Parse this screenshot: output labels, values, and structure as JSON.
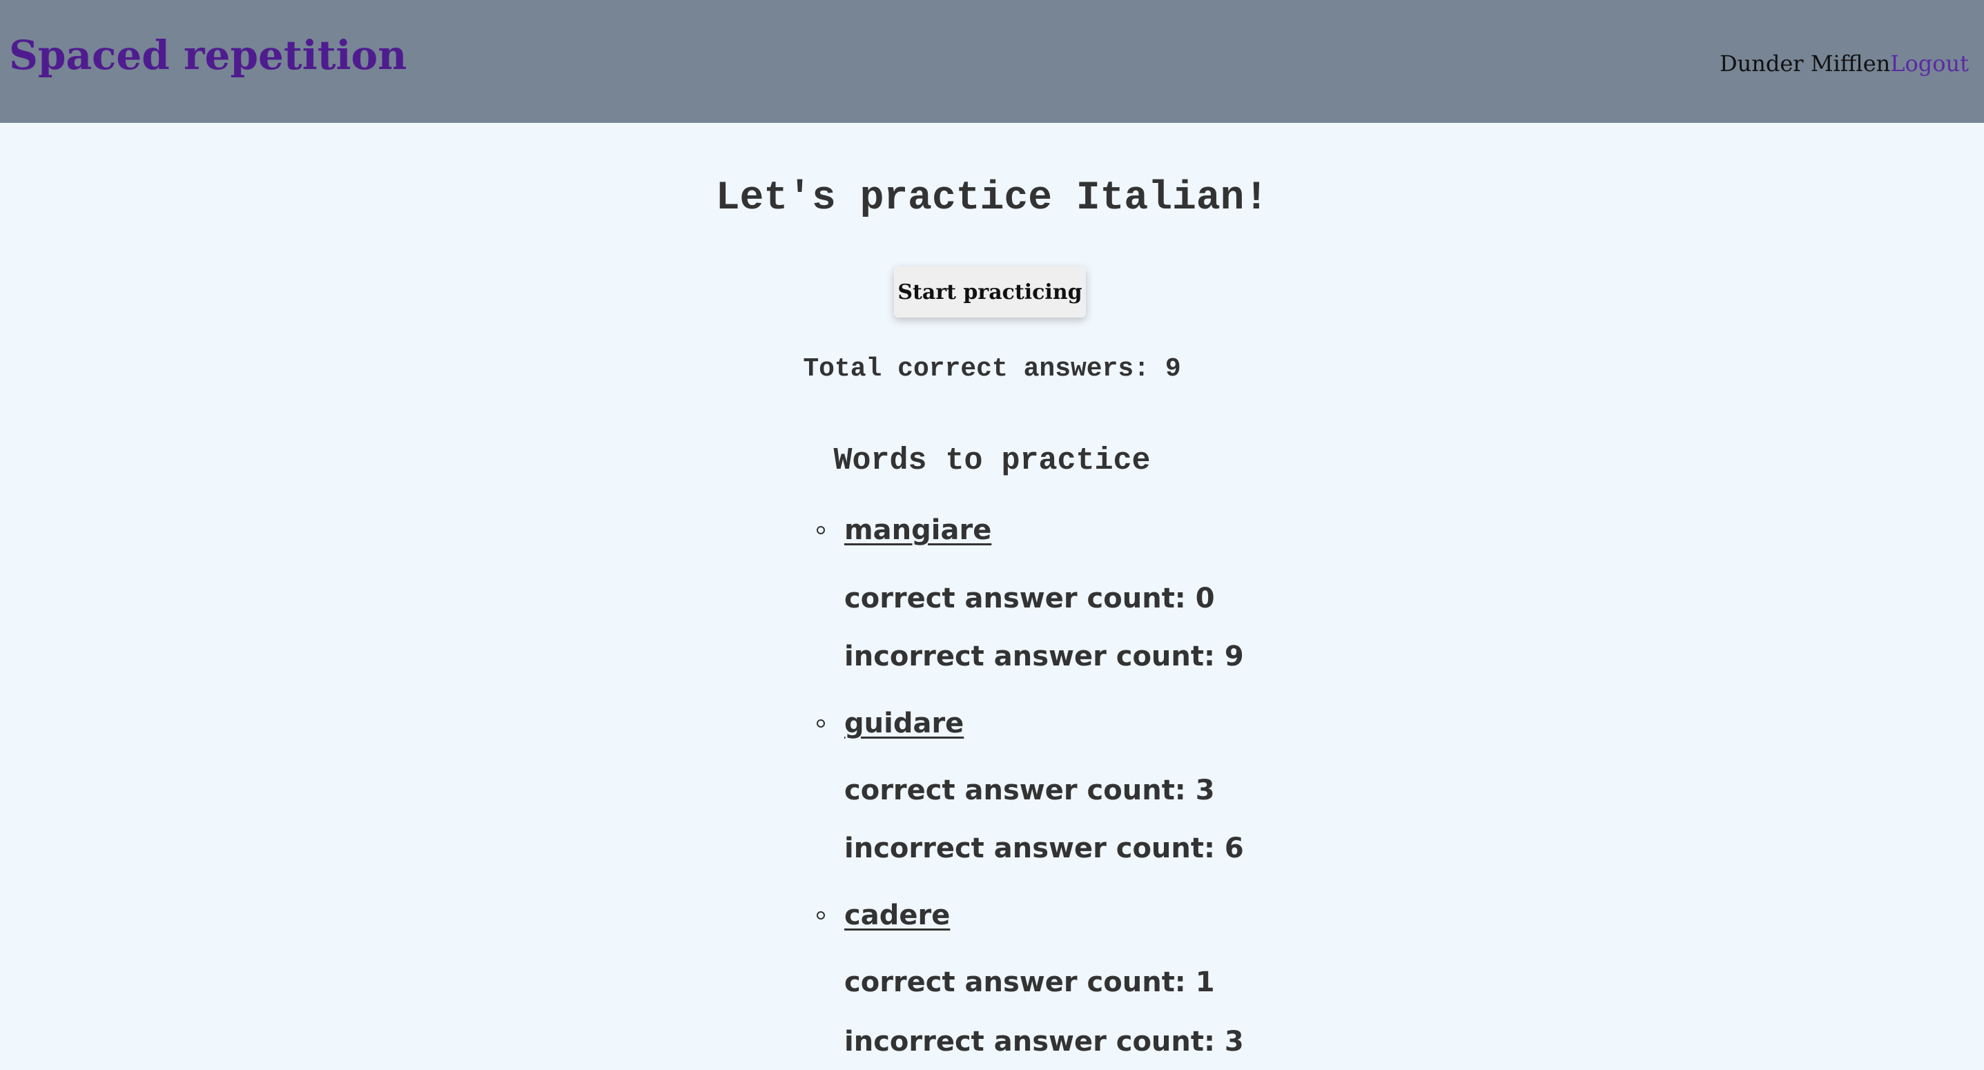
{
  "header": {
    "app_title": "Spaced repetition",
    "user_name": "Dunder Mifflen",
    "logout_label": "Logout"
  },
  "dashboard": {
    "heading": "Let's practice Italian!",
    "start_button_label": "Start practicing",
    "total_correct_label": "Total correct answers: 9",
    "words_heading": "Words to practice",
    "words": [
      {
        "word": "mangiare",
        "correct_label": "correct answer count: 0",
        "incorrect_label": "incorrect answer count: 9"
      },
      {
        "word": "guidare",
        "correct_label": "correct answer count: 3",
        "incorrect_label": "incorrect answer count: 6"
      },
      {
        "word": "cadere",
        "correct_label": "correct answer count: 1",
        "incorrect_label": "incorrect answer count: 3"
      }
    ]
  }
}
